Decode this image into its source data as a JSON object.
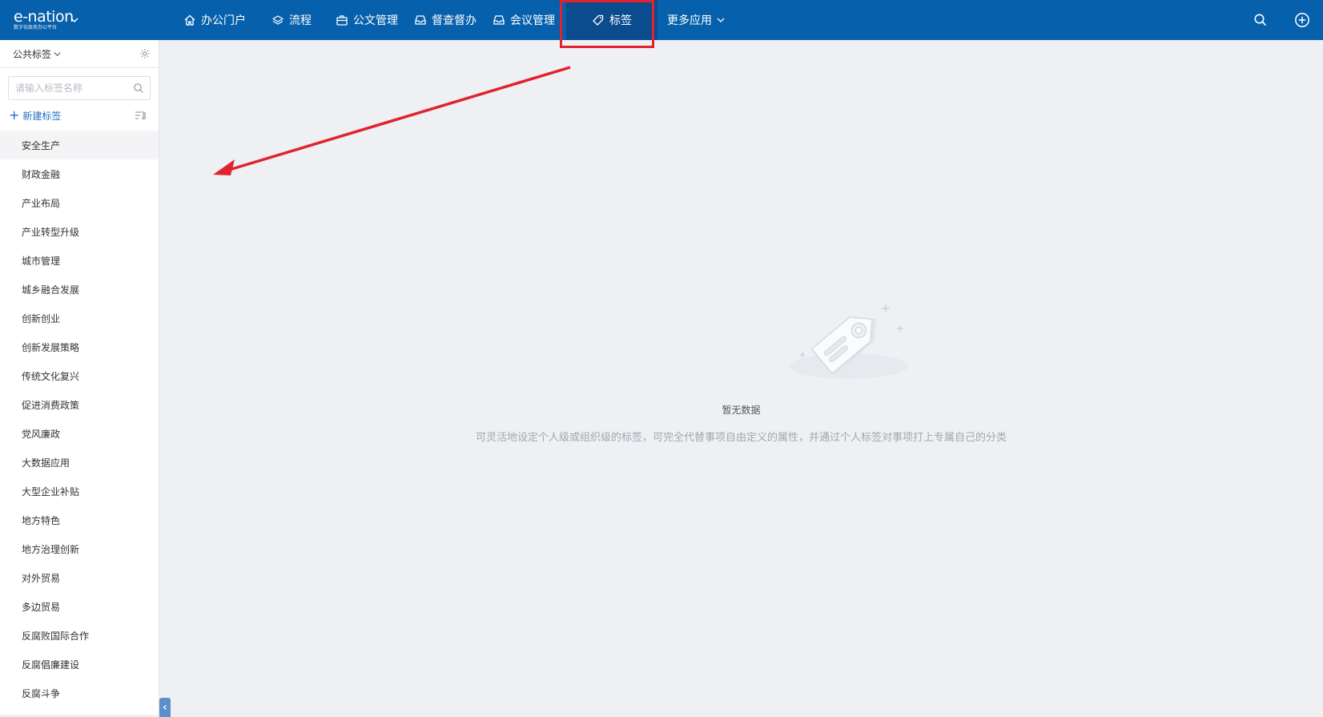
{
  "app": {
    "logo_text": "e-nation",
    "logo_subtext": "数字化政务办公平台"
  },
  "nav": {
    "items": [
      {
        "label": "办公门户",
        "icon": "home-icon"
      },
      {
        "label": "流程",
        "icon": "layers-icon"
      },
      {
        "label": "公文管理",
        "icon": "briefcase-icon"
      },
      {
        "label": "督查督办",
        "icon": "inbox-icon"
      },
      {
        "label": "会议管理",
        "icon": "inbox-icon"
      },
      {
        "label": "标签",
        "icon": "tag-icon",
        "active": true
      },
      {
        "label": "更多应用",
        "icon": "chevron-down-icon"
      }
    ]
  },
  "sidebar": {
    "scope_label": "公共标签",
    "search_placeholder": "请输入标签名称",
    "new_tag_label": "新建标签",
    "tags": [
      "安全生产",
      "财政金融",
      "产业布局",
      "产业转型升级",
      "城市管理",
      "城乡融合发展",
      "创新创业",
      "创新发展策略",
      "传统文化复兴",
      "促进消费政策",
      "党风廉政",
      "大数据应用",
      "大型企业补贴",
      "地方特色",
      "地方治理创新",
      "对外贸易",
      "多边贸易",
      "反腐败国际合作",
      "反腐倡廉建设",
      "反腐斗争"
    ],
    "selected_index": 0
  },
  "empty_state": {
    "title": "暂无数据",
    "description": "可灵活地设定个人级或组织级的标签，可完全代替事项自由定义的属性，并通过个人标签对事项打上专属自己的分类"
  },
  "colors": {
    "topbar": "#0760ab",
    "nav_active": "#0a4c8d",
    "annotation": "#e0232f",
    "link": "#1f6fc4"
  }
}
